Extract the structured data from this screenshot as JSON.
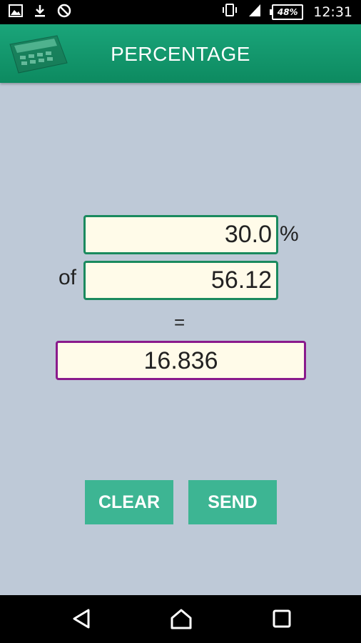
{
  "status_bar": {
    "icons_left": [
      "image-icon",
      "download-icon",
      "blocked-icon"
    ],
    "vibrate_icon": "vibrate-icon",
    "signal_icon": "signal-icon",
    "battery": "48%",
    "time": "12:31"
  },
  "header": {
    "title": "PERCENTAGE",
    "logo_icon": "calculator-icon"
  },
  "form": {
    "percent_value": "30.0",
    "percent_sign": "%",
    "of_label": "of",
    "of_value": "56.12",
    "equals_sign": "=",
    "result_value": "16.836"
  },
  "buttons": {
    "clear_label": "CLEAR",
    "send_label": "SEND"
  },
  "nav": {
    "back_icon": "back-icon",
    "home_icon": "home-icon",
    "recents_icon": "recents-icon"
  },
  "colors": {
    "header": "#0d8a60",
    "button": "#3db593",
    "background": "#bec9d7",
    "input_border": "#1a8a5e",
    "result_border": "#8a1a8c",
    "field_fill": "#fffbe9"
  }
}
